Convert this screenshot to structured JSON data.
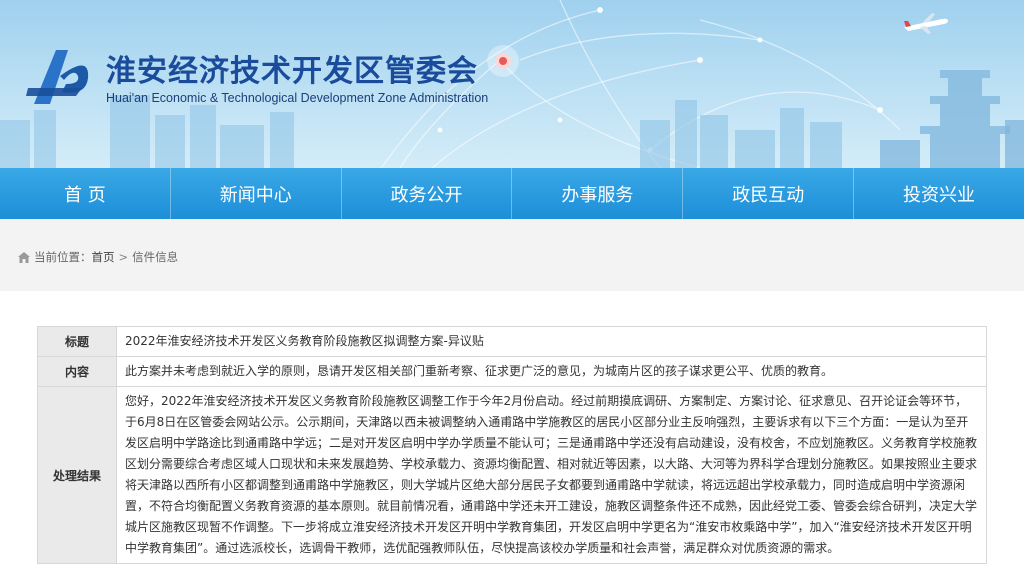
{
  "header": {
    "title": "淮安经济技术开发区管委会",
    "subtitle": "Huai'an Economic & Technological Development Zone Administration"
  },
  "nav": {
    "items": [
      {
        "label": "首 页"
      },
      {
        "label": "新闻中心"
      },
      {
        "label": "政务公开"
      },
      {
        "label": "办事服务"
      },
      {
        "label": "政民互动"
      },
      {
        "label": "投资兴业"
      }
    ]
  },
  "breadcrumb": {
    "prefix": "当前位置：",
    "home": "首页",
    "separator": ">",
    "current": "信件信息"
  },
  "detail": {
    "title_label": "标题",
    "title_value": "2022年淮安经济技术开发区义务教育阶段施教区拟调整方案-异议贴",
    "content_label": "内容",
    "content_value": "此方案并未考虑到就近入学的原则，恳请开发区相关部门重新考察、征求更广泛的意见，为城南片区的孩子谋求更公平、优质的教育。",
    "result_label": "处理结果",
    "result_value": "您好，2022年淮安经济技术开发区义务教育阶段施教区调整工作于今年2月份启动。经过前期摸底调研、方案制定、方案讨论、征求意见、召开论证会等环节，于6月8日在区管委会网站公示。公示期间，天津路以西未被调整纳入通甫路中学施教区的居民小区部分业主反响强烈，主要诉求有以下三个方面：一是认为至开发区启明中学路途比到通甫路中学远；二是对开发区启明中学办学质量不能认可；三是通甫路中学还没有启动建设，没有校舍，不应划施教区。义务教育学校施教区划分需要综合考虑区域人口现状和未来发展趋势、学校承载力、资源均衡配置、相对就近等因素，以大路、大河等为界科学合理划分施教区。如果按照业主要求将天津路以西所有小区都调整到通甫路中学施教区，则大学城片区绝大部分居民子女都要到通甫路中学就读，将远远超出学校承载力，同时造成启明中学资源闲置，不符合均衡配置义务教育资源的基本原则。就目前情况看，通甫路中学还未开工建设，施教区调整条件还不成熟，因此经党工委、管委会综合研判，决定大学城片区施教区现暂不作调整。下一步将成立淮安经济技术开发区开明中学教育集团，开发区启明中学更名为“淮安市枚乘路中学”，加入“淮安经济技术开发区开明中学教育集团”。通过选派校长，选调骨干教师，选优配强教师队伍，尽快提高该校办学质量和社会声誉，满足群众对优质资源的需求。"
  },
  "colors": {
    "title": "#1b4c9c",
    "nav": "#2196dc",
    "label_bg": "#eaeaea"
  },
  "icons": [
    "logo-icon",
    "plane-icon",
    "home-icon"
  ]
}
